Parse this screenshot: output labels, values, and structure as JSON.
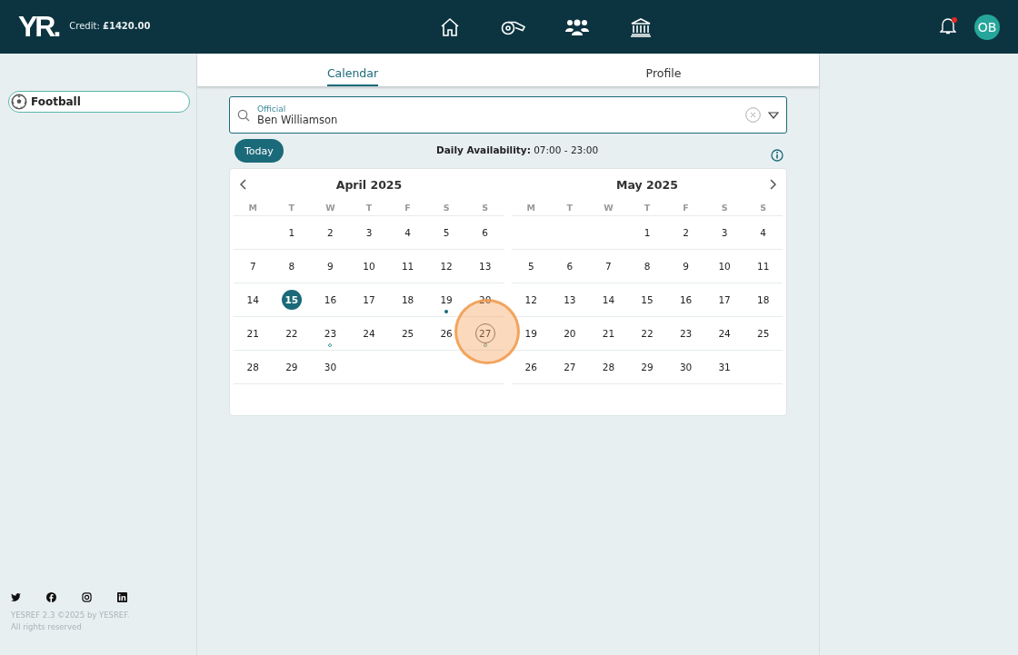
{
  "header": {
    "logo": "YR.",
    "credit_label": "Credit:",
    "credit_value": "£1420.00",
    "nav": [
      {
        "kind": "home"
      },
      {
        "kind": "whistle"
      },
      {
        "kind": "people"
      },
      {
        "kind": "bank"
      }
    ],
    "notifications": {
      "unread": true
    },
    "avatar": "OB"
  },
  "sidebar": {
    "items": [
      {
        "label": "Football",
        "selected": true
      }
    ],
    "social": [
      {
        "kind": "twitter"
      },
      {
        "kind": "facebook"
      },
      {
        "kind": "instagram"
      },
      {
        "kind": "linkedin"
      }
    ],
    "footer": [
      "YESREF 2.3 ©2025 by YESREF.",
      "All rights reserved"
    ]
  },
  "tabs": [
    {
      "label": "Calendar",
      "selected": true
    },
    {
      "label": "Profile",
      "selected": false
    }
  ],
  "official": {
    "label": "Official",
    "value": "Ben Williamson"
  },
  "today_button": "Today",
  "availability": "**Daily Availability:** 07:00 - 23:00",
  "months": [
    {
      "title": "April 2025",
      "weekdays": [
        "M",
        "T",
        "W",
        "T",
        "F",
        "S",
        "S"
      ],
      "weeks": [
        [
          {
            "kind": "blank"
          },
          {
            "kind": "day",
            "n": "1",
            "today": false,
            "selected": false
          },
          {
            "kind": "day",
            "n": "2",
            "today": false,
            "selected": false
          },
          {
            "kind": "day",
            "n": "3",
            "today": false,
            "selected": false
          },
          {
            "kind": "day",
            "n": "4",
            "today": false,
            "selected": false
          },
          {
            "kind": "day",
            "n": "5",
            "today": false,
            "selected": false
          },
          {
            "kind": "day",
            "n": "6",
            "today": false,
            "selected": false
          }
        ],
        [
          {
            "kind": "day",
            "n": "7",
            "today": false,
            "selected": false
          },
          {
            "kind": "day",
            "n": "8",
            "today": false,
            "selected": false
          },
          {
            "kind": "day",
            "n": "9",
            "today": false,
            "selected": false
          },
          {
            "kind": "day",
            "n": "10",
            "today": false,
            "selected": false
          },
          {
            "kind": "day",
            "n": "11",
            "today": false,
            "selected": false
          },
          {
            "kind": "day",
            "n": "12",
            "today": false,
            "selected": false
          },
          {
            "kind": "day",
            "n": "13",
            "today": false,
            "selected": false
          }
        ],
        [
          {
            "kind": "day",
            "n": "14",
            "today": false,
            "selected": false
          },
          {
            "kind": "day",
            "n": "15",
            "today": true,
            "selected": false
          },
          {
            "kind": "day",
            "n": "16",
            "today": false,
            "selected": false
          },
          {
            "kind": "day",
            "n": "17",
            "today": false,
            "selected": false
          },
          {
            "kind": "day",
            "n": "18",
            "today": false,
            "selected": false
          },
          {
            "kind": "dotted",
            "n": "19",
            "today": false,
            "selected": false
          },
          {
            "kind": "day",
            "n": "20",
            "today": false,
            "selected": false
          }
        ],
        [
          {
            "kind": "day",
            "n": "21",
            "today": false,
            "selected": false
          },
          {
            "kind": "day",
            "n": "22",
            "today": false,
            "selected": false
          },
          {
            "kind": "ringed",
            "n": "23",
            "today": false,
            "selected": false
          },
          {
            "kind": "day",
            "n": "24",
            "today": false,
            "selected": false
          },
          {
            "kind": "day",
            "n": "25",
            "today": false,
            "selected": false
          },
          {
            "kind": "day",
            "n": "26",
            "today": false,
            "selected": false
          },
          {
            "kind": "ringed",
            "n": "27",
            "today": false,
            "selected": true
          }
        ],
        [
          {
            "kind": "day",
            "n": "28",
            "today": false,
            "selected": false
          },
          {
            "kind": "day",
            "n": "29",
            "today": false,
            "selected": false
          },
          {
            "kind": "day",
            "n": "30",
            "today": false,
            "selected": false
          },
          {
            "kind": "blank"
          },
          {
            "kind": "blank"
          },
          {
            "kind": "blank"
          },
          {
            "kind": "blank"
          }
        ]
      ]
    },
    {
      "title": "May 2025",
      "weekdays": [
        "M",
        "T",
        "W",
        "T",
        "F",
        "S",
        "S"
      ],
      "weeks": [
        [
          {
            "kind": "blank"
          },
          {
            "kind": "blank"
          },
          {
            "kind": "blank"
          },
          {
            "kind": "day",
            "n": "1",
            "today": false,
            "selected": false
          },
          {
            "kind": "day",
            "n": "2",
            "today": false,
            "selected": false
          },
          {
            "kind": "day",
            "n": "3",
            "today": false,
            "selected": false
          },
          {
            "kind": "day",
            "n": "4",
            "today": false,
            "selected": false
          }
        ],
        [
          {
            "kind": "day",
            "n": "5",
            "today": false,
            "selected": false
          },
          {
            "kind": "day",
            "n": "6",
            "today": false,
            "selected": false
          },
          {
            "kind": "day",
            "n": "7",
            "today": false,
            "selected": false
          },
          {
            "kind": "day",
            "n": "8",
            "today": false,
            "selected": false
          },
          {
            "kind": "day",
            "n": "9",
            "today": false,
            "selected": false
          },
          {
            "kind": "day",
            "n": "10",
            "today": false,
            "selected": false
          },
          {
            "kind": "day",
            "n": "11",
            "today": false,
            "selected": false
          }
        ],
        [
          {
            "kind": "day",
            "n": "12",
            "today": false,
            "selected": false
          },
          {
            "kind": "day",
            "n": "13",
            "today": false,
            "selected": false
          },
          {
            "kind": "day",
            "n": "14",
            "today": false,
            "selected": false
          },
          {
            "kind": "day",
            "n": "15",
            "today": false,
            "selected": false
          },
          {
            "kind": "day",
            "n": "16",
            "today": false,
            "selected": false
          },
          {
            "kind": "day",
            "n": "17",
            "today": false,
            "selected": false
          },
          {
            "kind": "day",
            "n": "18",
            "today": false,
            "selected": false
          }
        ],
        [
          {
            "kind": "day",
            "n": "19",
            "today": false,
            "selected": false
          },
          {
            "kind": "day",
            "n": "20",
            "today": false,
            "selected": false
          },
          {
            "kind": "day",
            "n": "21",
            "today": false,
            "selected": false
          },
          {
            "kind": "day",
            "n": "22",
            "today": false,
            "selected": false
          },
          {
            "kind": "day",
            "n": "23",
            "today": false,
            "selected": false
          },
          {
            "kind": "day",
            "n": "24",
            "today": false,
            "selected": false
          },
          {
            "kind": "day",
            "n": "25",
            "today": false,
            "selected": false
          }
        ],
        [
          {
            "kind": "day",
            "n": "26",
            "today": false,
            "selected": false
          },
          {
            "kind": "day",
            "n": "27",
            "today": false,
            "selected": false
          },
          {
            "kind": "day",
            "n": "28",
            "today": false,
            "selected": false
          },
          {
            "kind": "day",
            "n": "29",
            "today": false,
            "selected": false
          },
          {
            "kind": "day",
            "n": "30",
            "today": false,
            "selected": false
          },
          {
            "kind": "day",
            "n": "31",
            "today": false,
            "selected": false
          },
          {
            "kind": "blank"
          }
        ]
      ]
    }
  ]
}
